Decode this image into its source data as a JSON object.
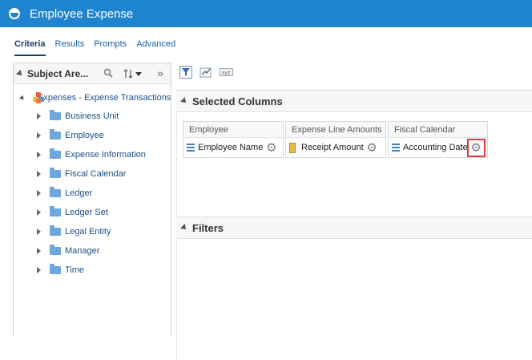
{
  "app": {
    "title": "Employee Expense"
  },
  "tabs": [
    {
      "label": "Criteria",
      "active": true
    },
    {
      "label": "Results",
      "active": false
    },
    {
      "label": "Prompts",
      "active": false
    },
    {
      "label": "Advanced",
      "active": false
    }
  ],
  "subject_area": {
    "header": "Subject Are...",
    "root_label": "Expenses - Expense Transactions",
    "folders": [
      "Business Unit",
      "Employee",
      "Expense Information",
      "Fiscal Calendar",
      "Ledger",
      "Ledger Set",
      "Legal Entity",
      "Manager",
      "Time"
    ]
  },
  "selected_columns": {
    "title": "Selected Columns",
    "columns": [
      {
        "heading": "Employee",
        "field": "Employee Name",
        "kind": "attribute"
      },
      {
        "heading": "Expense Line Amounts",
        "field": "Receipt Amount",
        "kind": "measure"
      },
      {
        "heading": "Fiscal Calendar",
        "field": "Accounting Date",
        "kind": "attribute",
        "gear_highlighted": true
      }
    ]
  },
  "filters": {
    "title": "Filters"
  },
  "colors": {
    "titlebar": "#1e84d0",
    "highlight": "#e03c3c",
    "link": "#1b62a3"
  }
}
